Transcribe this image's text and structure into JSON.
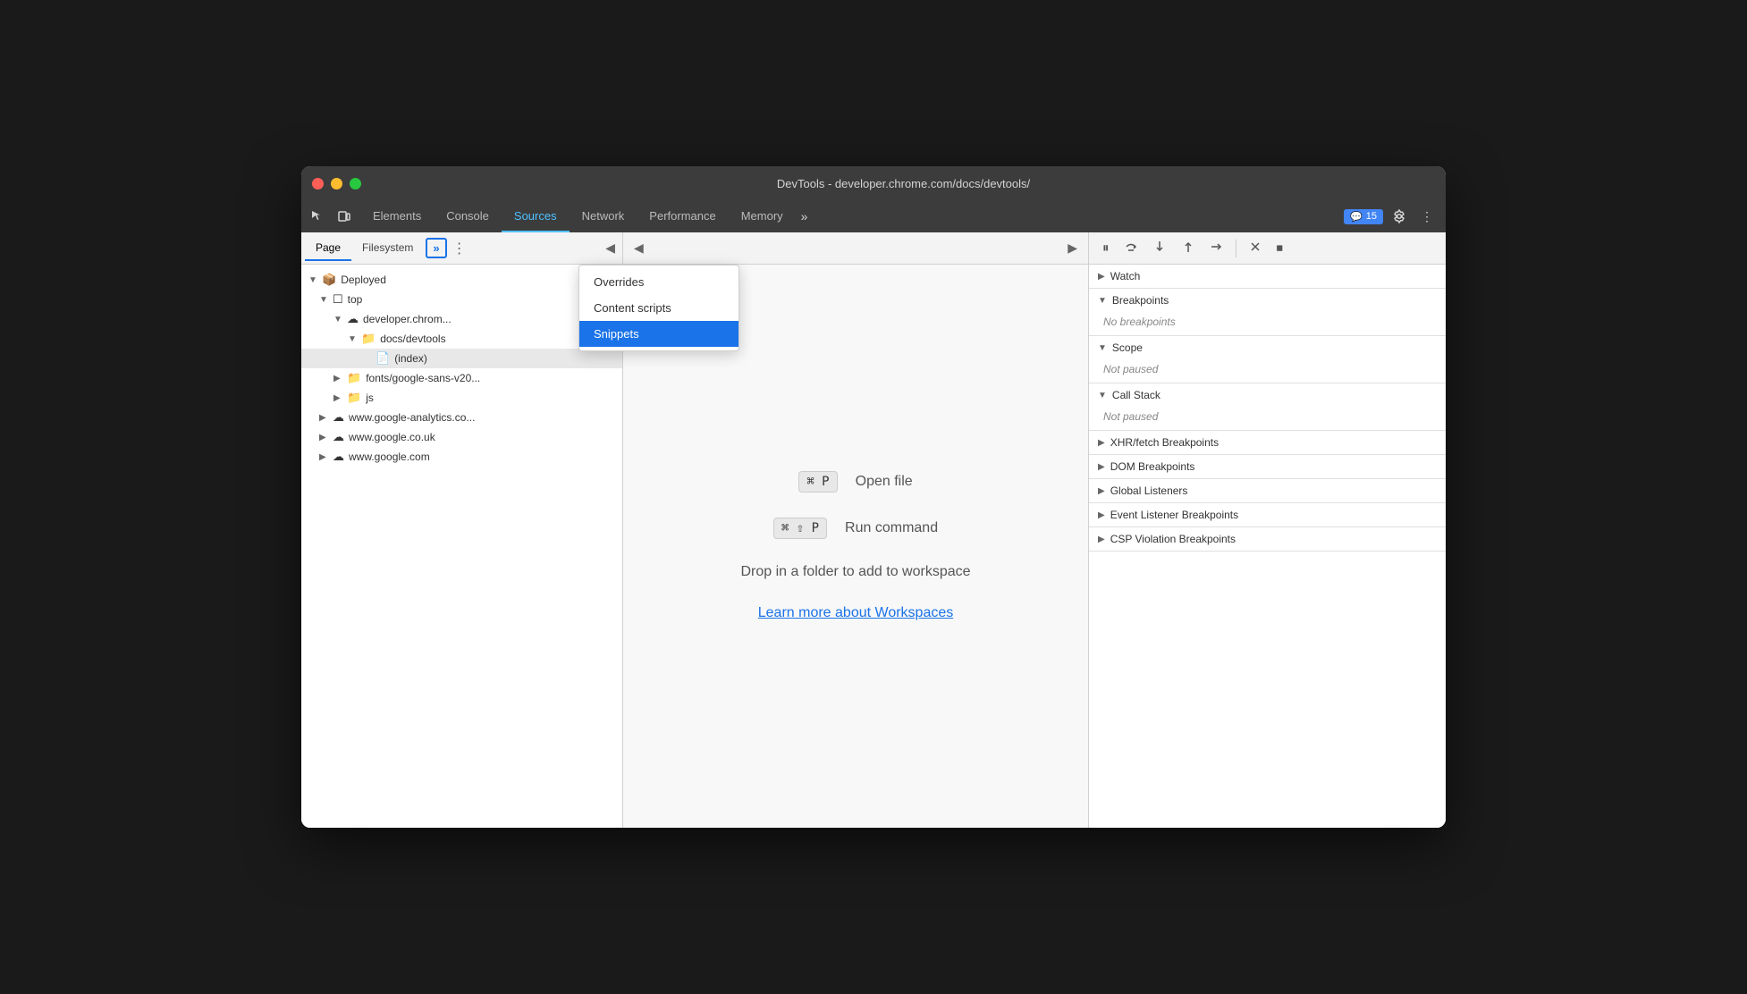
{
  "window": {
    "title": "DevTools - developer.chrome.com/docs/devtools/"
  },
  "tabs": {
    "items": [
      {
        "id": "elements",
        "label": "Elements",
        "active": false
      },
      {
        "id": "console",
        "label": "Console",
        "active": false
      },
      {
        "id": "sources",
        "label": "Sources",
        "active": true
      },
      {
        "id": "network",
        "label": "Network",
        "active": false
      },
      {
        "id": "performance",
        "label": "Performance",
        "active": false
      },
      {
        "id": "memory",
        "label": "Memory",
        "active": false
      }
    ],
    "more_label": "»",
    "notification": {
      "icon": "💬",
      "count": "15"
    }
  },
  "sources_panel": {
    "tabs": [
      {
        "id": "page",
        "label": "Page",
        "active": true
      },
      {
        "id": "filesystem",
        "label": "Filesystem",
        "active": false
      }
    ],
    "more_label": "»"
  },
  "file_tree": {
    "items": [
      {
        "id": "deployed",
        "label": "Deployed",
        "indent": 0,
        "icon": "📦",
        "chevron": "▼",
        "type": "folder"
      },
      {
        "id": "top",
        "label": "top",
        "indent": 1,
        "icon": "□",
        "chevron": "▼",
        "type": "folder"
      },
      {
        "id": "developer-chrome",
        "label": "developer.chrom...",
        "indent": 2,
        "icon": "☁",
        "chevron": "▼",
        "type": "domain"
      },
      {
        "id": "docs-devtools",
        "label": "docs/devtools",
        "indent": 3,
        "icon": "📁",
        "chevron": "▼",
        "type": "folder"
      },
      {
        "id": "index",
        "label": "(index)",
        "indent": 4,
        "icon": "📄",
        "chevron": "",
        "type": "file",
        "selected": true
      },
      {
        "id": "fonts-google",
        "label": "fonts/google-sans-v20...",
        "indent": 2,
        "icon": "📁",
        "chevron": "▶",
        "type": "folder"
      },
      {
        "id": "js",
        "label": "js",
        "indent": 2,
        "icon": "📁",
        "chevron": "▶",
        "type": "folder"
      },
      {
        "id": "google-analytics",
        "label": "www.google-analytics.co...",
        "indent": 1,
        "icon": "☁",
        "chevron": "▶",
        "type": "domain"
      },
      {
        "id": "google-co-uk",
        "label": "www.google.co.uk",
        "indent": 1,
        "icon": "☁",
        "chevron": "▶",
        "type": "domain"
      },
      {
        "id": "google-com",
        "label": "www.google.com",
        "indent": 1,
        "icon": "☁",
        "chevron": "▶",
        "type": "domain"
      }
    ]
  },
  "editor": {
    "shortcuts": [
      {
        "id": "open-file",
        "keys": "⌘ P",
        "label": "Open file"
      },
      {
        "id": "run-command",
        "keys": "⌘ ⇧ P",
        "label": "Run command"
      }
    ],
    "drop_text": "Drop in a folder to add to workspace",
    "workspace_link": "Learn more about Workspaces"
  },
  "dropdown": {
    "items": [
      {
        "id": "overrides",
        "label": "Overrides",
        "active": false
      },
      {
        "id": "content-scripts",
        "label": "Content scripts",
        "active": false
      },
      {
        "id": "snippets",
        "label": "Snippets",
        "active": true
      }
    ]
  },
  "debugger": {
    "buttons": [
      {
        "id": "pause",
        "icon": "⏸",
        "label": "Pause"
      },
      {
        "id": "step-over",
        "icon": "↺",
        "label": "Step over"
      },
      {
        "id": "step-into",
        "icon": "↓",
        "label": "Step into"
      },
      {
        "id": "step-out",
        "icon": "↑",
        "label": "Step out"
      },
      {
        "id": "step",
        "icon": "→",
        "label": "Step"
      },
      {
        "id": "deactivate",
        "icon": "✏",
        "label": "Deactivate"
      },
      {
        "id": "stop",
        "icon": "⏹",
        "label": "Stop"
      }
    ],
    "sections": [
      {
        "id": "watch",
        "label": "Watch",
        "expanded": false,
        "content": ""
      },
      {
        "id": "breakpoints",
        "label": "Breakpoints",
        "expanded": true,
        "content": "No breakpoints",
        "italic": true
      },
      {
        "id": "scope",
        "label": "Scope",
        "expanded": true,
        "content": "Not paused",
        "italic": true
      },
      {
        "id": "call-stack",
        "label": "Call Stack",
        "expanded": true,
        "content": "Not paused",
        "italic": true
      },
      {
        "id": "xhr-fetch",
        "label": "XHR/fetch Breakpoints",
        "expanded": false,
        "content": ""
      },
      {
        "id": "dom-breakpoints",
        "label": "DOM Breakpoints",
        "expanded": false,
        "content": ""
      },
      {
        "id": "global-listeners",
        "label": "Global Listeners",
        "expanded": false,
        "content": ""
      },
      {
        "id": "event-listener-breakpoints",
        "label": "Event Listener Breakpoints",
        "expanded": false,
        "content": ""
      },
      {
        "id": "csp-violation",
        "label": "CSP Violation Breakpoints",
        "expanded": false,
        "content": ""
      }
    ]
  }
}
